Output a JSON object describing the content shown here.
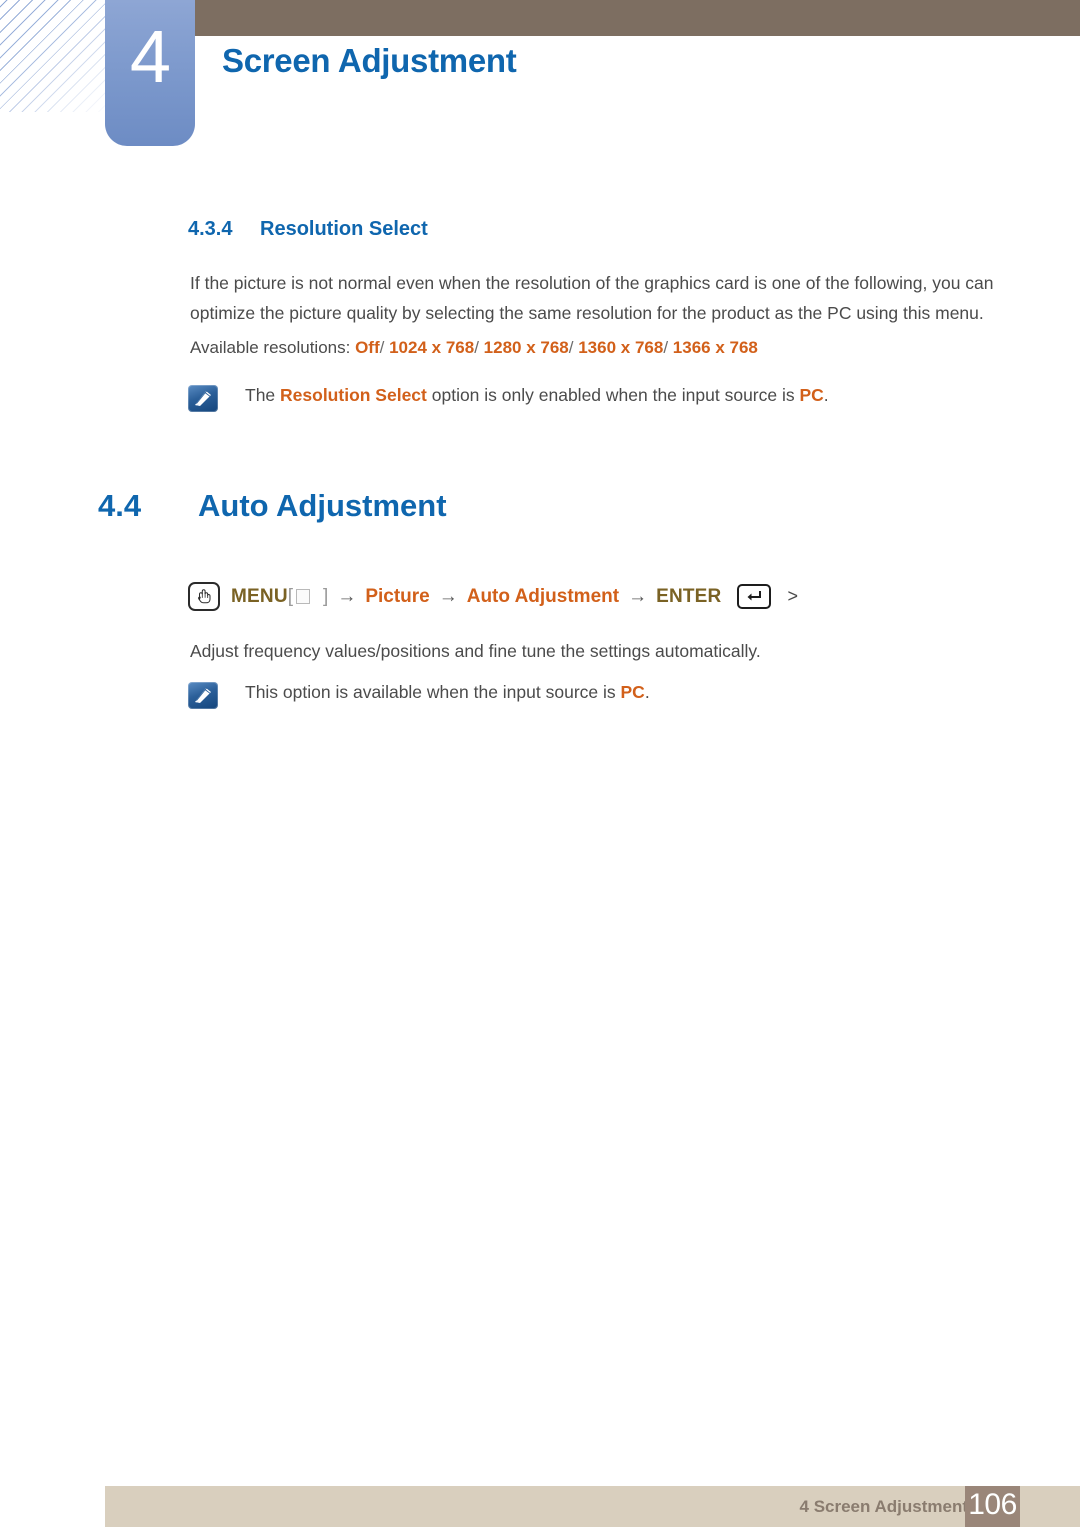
{
  "header": {
    "chapter_number": "4",
    "chapter_title": "Screen Adjustment"
  },
  "content": {
    "subsection": {
      "number": "4.3.4",
      "title": "Resolution Select"
    },
    "intro_paragraph": "If the picture is not normal even when the resolution of the graphics card is one of the following, you can optimize the picture quality by selecting the same resolution for the product as the PC using this menu.",
    "resolutions": {
      "label": "Available resolutions:",
      "values": [
        "Off",
        "1024 x 768",
        "1280 x 768",
        "1360 x 768",
        "1366 x 768"
      ],
      "separator": "/"
    },
    "note_resolution": {
      "text_before": "The ",
      "highlight_1": "Resolution Select",
      "text_middle": " option is only enabled when the input source is ",
      "highlight_2": "PC",
      "text_after": "."
    },
    "section": {
      "number": "4.4",
      "title": "Auto Adjustment"
    },
    "menu_path": {
      "menu_label": "MENU",
      "bracket_open": "[",
      "bracket_close": "]",
      "arrow": "→",
      "item_1": "Picture",
      "item_2": "Auto Adjustment",
      "enter_label": "ENTER",
      "trailing": ">"
    },
    "auto_adjustment_description": "Adjust frequency values/positions and fine tune the settings automatically.",
    "note_auto": {
      "text_before": "This option is available when the input source is ",
      "highlight_1": "PC",
      "text_after": "."
    }
  },
  "footer": {
    "label": "4 Screen Adjustment",
    "page_number": "106"
  },
  "colors": {
    "heading_blue": "#0f66ae",
    "accent_orange": "#d2601a",
    "menu_olive": "#7a6224",
    "header_brown": "#7d6e61",
    "badge_blue": "#7e9acd",
    "footer_tan": "#d9cfbe",
    "page_box_brown": "#9a8679",
    "body_gray": "#4b4b4b"
  }
}
